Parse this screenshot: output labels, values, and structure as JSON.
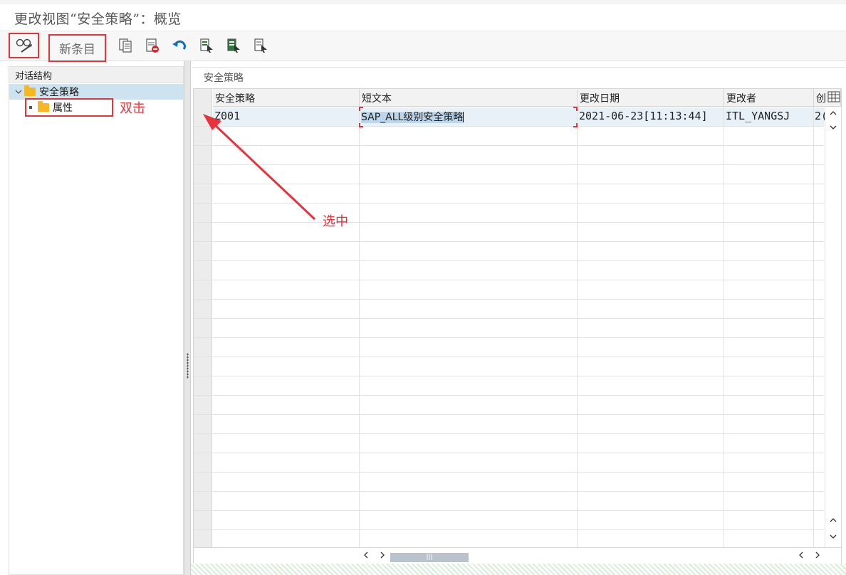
{
  "window": {
    "title": "更改视图“安全策略”：概览"
  },
  "toolbar": {
    "new_entry_label": "新条目",
    "icons": [
      "display-change-icon",
      "copy-icon",
      "delete-icon",
      "undo-icon",
      "select-all-icon",
      "select-block-icon",
      "deselect-all-icon"
    ]
  },
  "tree": {
    "header": "对话结构",
    "items": [
      {
        "label": "安全策略",
        "selected": true
      },
      {
        "label": "属性",
        "selected": false
      }
    ]
  },
  "section": {
    "title": "安全策略"
  },
  "table": {
    "columns": [
      "安全策略",
      "短文本",
      "更改日期",
      "更改者",
      "创"
    ],
    "rows": [
      {
        "policy": "Z001",
        "short_text": "SAP_ALL级别安全策略",
        "changed_on": "2021-06-23[11:13:44]",
        "changed_by": "ITL_YANGSJ",
        "created": "2("
      }
    ]
  },
  "annotations": {
    "double_click": "双击",
    "selected": "选中"
  },
  "colors": {
    "annotation_red": "#e8333a",
    "selection_blue": "#cde3f0",
    "folder_yellow": "#f5b823"
  }
}
